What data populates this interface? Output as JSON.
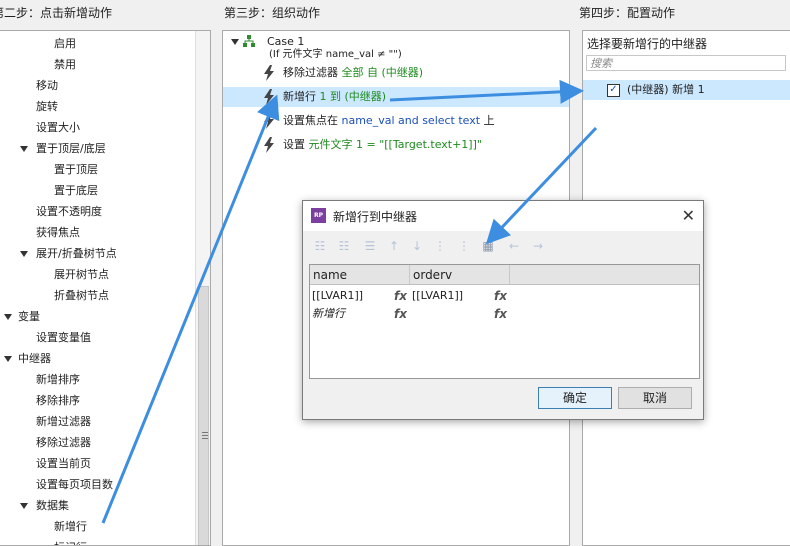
{
  "headers": {
    "step2": "第二步：点击新增动作",
    "step3": "第三步：组织动作",
    "step4": "第四步：配置动作"
  },
  "left_tree": [
    {
      "label": "启用",
      "level": 3,
      "expand": false
    },
    {
      "label": "禁用",
      "level": 3,
      "expand": false
    },
    {
      "label": "移动",
      "level": 2,
      "expand": false
    },
    {
      "label": "旋转",
      "level": 2,
      "expand": false
    },
    {
      "label": "设置大小",
      "level": 2,
      "expand": false
    },
    {
      "label": "置于顶层/底层",
      "level": 2,
      "expand": true
    },
    {
      "label": "置于顶层",
      "level": 3,
      "expand": false
    },
    {
      "label": "置于底层",
      "level": 3,
      "expand": false
    },
    {
      "label": "设置不透明度",
      "level": 2,
      "expand": false
    },
    {
      "label": "获得焦点",
      "level": 2,
      "expand": false
    },
    {
      "label": "展开/折叠树节点",
      "level": 2,
      "expand": true
    },
    {
      "label": "展开树节点",
      "level": 3,
      "expand": false
    },
    {
      "label": "折叠树节点",
      "level": 3,
      "expand": false
    },
    {
      "label": "变量",
      "level": 1,
      "expand": true
    },
    {
      "label": "设置变量值",
      "level": 2,
      "expand": false
    },
    {
      "label": "中继器",
      "level": 1,
      "expand": true
    },
    {
      "label": "新增排序",
      "level": 2,
      "expand": false
    },
    {
      "label": "移除排序",
      "level": 2,
      "expand": false
    },
    {
      "label": "新增过滤器",
      "level": 2,
      "expand": false
    },
    {
      "label": "移除过滤器",
      "level": 2,
      "expand": false
    },
    {
      "label": "设置当前页",
      "level": 2,
      "expand": false
    },
    {
      "label": "设置每页项目数",
      "level": 2,
      "expand": false
    },
    {
      "label": "数据集",
      "level": 2,
      "expand": true
    },
    {
      "label": "新增行",
      "level": 3,
      "expand": false
    },
    {
      "label": "标记行",
      "level": 3,
      "expand": false
    }
  ],
  "middle": {
    "case_title": "Case 1",
    "case_condition": "(If 元件文字 name_val ≠ \"\")",
    "actions": [
      {
        "p1": "移除过滤器 ",
        "p2": "全部 自 (中继器)",
        "p2c": "g",
        "p3": "",
        "p4": "",
        "p4c": "",
        "selected": false
      },
      {
        "p1": "新增行 ",
        "p2": "1 到 (中继器)",
        "p2c": "g",
        "p3": "",
        "p4": "",
        "p4c": "",
        "selected": true
      },
      {
        "p1": "设置焦点在 ",
        "p2": "name_val and select text",
        "p2c": "b",
        "p3": " 上",
        "p4": "",
        "p4c": "",
        "selected": false
      },
      {
        "p1": "设置 ",
        "p2": "元件文字 1 = \"[[Target.text+1]]\"",
        "p2c": "g",
        "p3": "",
        "p4": "",
        "p4c": "",
        "selected": false
      }
    ]
  },
  "right": {
    "title": "选择要新增行的中继器",
    "search_placeholder": "搜索",
    "item_label": "(中继器) 新增 1",
    "item_checked": "✓"
  },
  "dialog": {
    "title": "新增行到中继器",
    "logo": "RP",
    "close": "✕",
    "columns": [
      "name",
      "orderv"
    ],
    "fx": "fx",
    "rows": [
      {
        "name": "[[LVAR1]]",
        "orderv": "[[LVAR1]]",
        "italic": false
      },
      {
        "name": "新增行",
        "orderv": "",
        "italic": true
      }
    ],
    "ok_label": "确定",
    "cancel_label": "取消",
    "toolbar_icons": [
      "insert-rows-icon",
      "insert-rows-below-icon",
      "delete-rows-icon",
      "move-up-icon",
      "move-down-icon",
      "insert-column-icon",
      "insert-column-right-icon",
      "delete-column-icon",
      "move-left-icon",
      "move-right-icon"
    ]
  },
  "colors": {
    "selection": "#cce8ff",
    "green_text": "#1f8a1f",
    "blue_text": "#1a4fb8",
    "arrow": "#3d8ee0"
  }
}
